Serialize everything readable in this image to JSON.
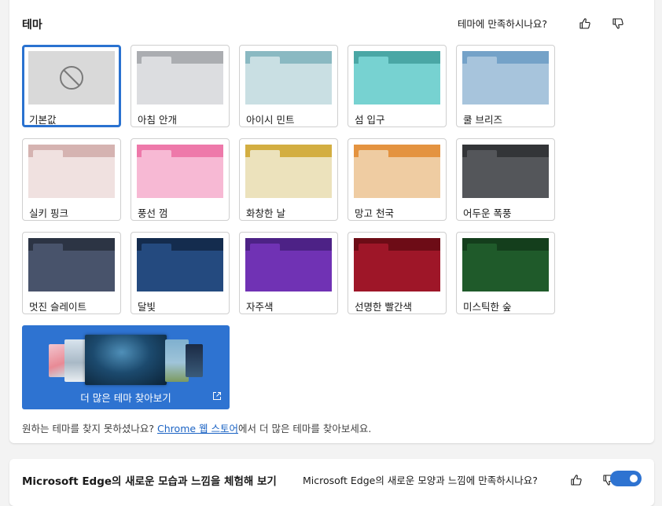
{
  "themes_section": {
    "title": "테마",
    "feedback_question": "테마에 만족하시나요?",
    "tiles": [
      {
        "label": "기본값",
        "selected": true,
        "top_color": "#d9d9d9",
        "body_color": "#d9d9d9",
        "tab_color": "#d9d9d9",
        "icon": "block-icon"
      },
      {
        "label": "아침 안개",
        "selected": false,
        "top_color": "#abadb1",
        "body_color": "#dcdde0",
        "tab_color": "#dcdde0"
      },
      {
        "label": "아이시 민트",
        "selected": false,
        "top_color": "#8ab9c2",
        "body_color": "#c9dfe3",
        "tab_color": "#c9dfe3"
      },
      {
        "label": "섬 입구",
        "selected": false,
        "top_color": "#4aa7a5",
        "body_color": "#77d2d1",
        "tab_color": "#77d2d1"
      },
      {
        "label": "쿨 브리즈",
        "selected": false,
        "top_color": "#74a2c8",
        "body_color": "#a7c4dc",
        "tab_color": "#a7c4dc"
      },
      {
        "label": "실키 핑크",
        "selected": false,
        "top_color": "#d5b3b1",
        "body_color": "#f0e1e0",
        "tab_color": "#f0e1e0"
      },
      {
        "label": "풍선 껌",
        "selected": false,
        "top_color": "#ee79aa",
        "body_color": "#f7b9d4",
        "tab_color": "#f7b9d4"
      },
      {
        "label": "화창한 날",
        "selected": false,
        "top_color": "#d3ae41",
        "body_color": "#ece2bc",
        "tab_color": "#ece2bc"
      },
      {
        "label": "망고 천국",
        "selected": false,
        "top_color": "#e49340",
        "body_color": "#efcca2",
        "tab_color": "#efcca2"
      },
      {
        "label": "어두운 폭풍",
        "selected": false,
        "top_color": "#333538",
        "body_color": "#54565a",
        "tab_color": "#54565a"
      },
      {
        "label": "멋진 슬레이트",
        "selected": false,
        "top_color": "#2c3444",
        "body_color": "#48536b",
        "tab_color": "#48536b"
      },
      {
        "label": "달빛",
        "selected": false,
        "top_color": "#142c4e",
        "body_color": "#244a7f",
        "tab_color": "#244a7f"
      },
      {
        "label": "자주색",
        "selected": false,
        "top_color": "#4d2286",
        "body_color": "#7032b4",
        "tab_color": "#7032b4"
      },
      {
        "label": "선명한 빨간색",
        "selected": false,
        "top_color": "#6d0c16",
        "body_color": "#9e1628",
        "tab_color": "#9e1628"
      },
      {
        "label": "미스틱한 숲",
        "selected": false,
        "top_color": "#143e1c",
        "body_color": "#1f5a2a",
        "tab_color": "#1f5a2a"
      }
    ],
    "explore_label": "더 많은 테마 찾아보기",
    "footnote_prefix": "원하는 테마를 찾지 못하셨나요? ",
    "footnote_link": "Chrome 웹 스토어",
    "footnote_suffix": "에서 더 많은 테마를 찾아보세요."
  },
  "edge_section": {
    "title": "Microsoft Edge의 새로운 모습과 느낌을 체험해 보기",
    "feedback_question": "Microsoft Edge의 새로운 모양과 느낌에 만족하시나요?",
    "toggle_on": true
  },
  "colors": {
    "accent": "#2e73d1",
    "link": "#1b63c4"
  }
}
